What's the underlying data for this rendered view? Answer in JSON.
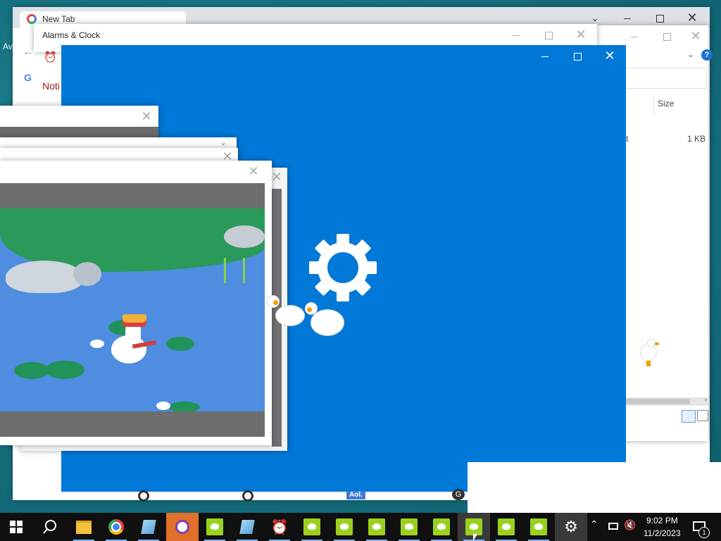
{
  "chrome_window": {
    "tab_title": "New Tab",
    "tab_sub": "Av",
    "notif_text": "Noti"
  },
  "explorer_window": {
    "size_header": "Size",
    "file_size": "1 KB",
    "col_letter": "t"
  },
  "alarms_window": {
    "title": "Alarms & Clock"
  },
  "settings_window": {
    "background": "#0078d7"
  },
  "bottom_labels": {
    "aol": "Aol.",
    "g": "G"
  },
  "taskbar": {
    "time": "9:02 PM",
    "date": "11/2/2023",
    "notification_count": "1",
    "items": [
      "start",
      "search",
      "file-explorer",
      "chrome",
      "notepad",
      "tor-browser",
      "goose",
      "notepad",
      "alarms",
      "goose",
      "goose",
      "goose",
      "goose",
      "goose",
      "goose",
      "goose",
      "goose",
      "settings"
    ]
  }
}
